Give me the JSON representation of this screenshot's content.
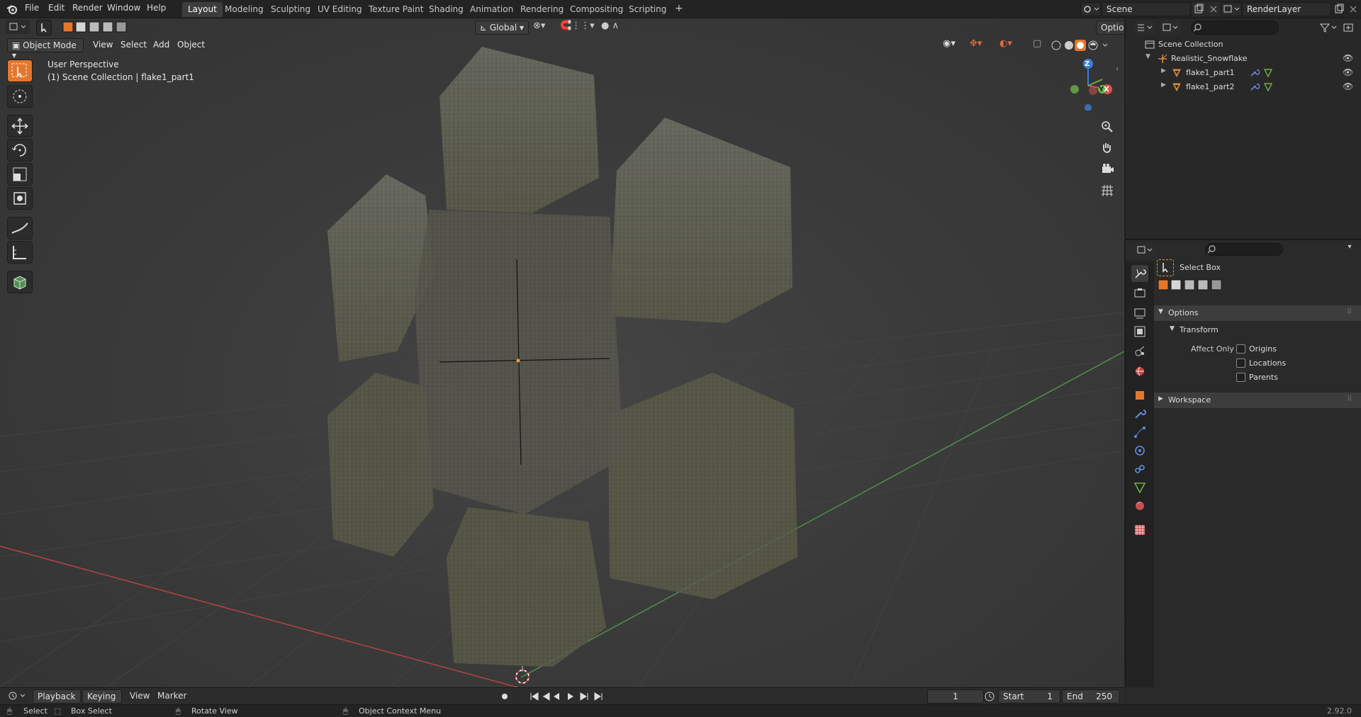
{
  "topbar": {
    "menu": [
      "File",
      "Edit",
      "Render",
      "Window",
      "Help"
    ],
    "workspaces": [
      "Layout",
      "Modeling",
      "Sculpting",
      "UV Editing",
      "Texture Paint",
      "Shading",
      "Animation",
      "Rendering",
      "Compositing",
      "Scripting"
    ],
    "active_workspace": "Layout",
    "add_workspace": "+",
    "scene_name": "Scene",
    "render_layer": "RenderLayer"
  },
  "viewport": {
    "mode": "Object Mode",
    "menu": [
      "View",
      "Select",
      "Add",
      "Object"
    ],
    "transform_orientation": "Global",
    "options_label": "Options",
    "perspective_label": "User Perspective",
    "collection_label": "(1) Scene Collection | flake1_part1",
    "gizmo": {
      "x": "X",
      "y": "Y",
      "z": "Z"
    }
  },
  "outliner": {
    "root": "Scene Collection",
    "collection": "Realistic_Snowflake",
    "objects": [
      "flake1_part1",
      "flake1_part2"
    ]
  },
  "properties": {
    "tool_name": "Select Box",
    "panels": {
      "options": "Options",
      "transform": "Transform",
      "affect_only_label": "Affect Only",
      "affect_options": [
        "Origins",
        "Locations",
        "Parents"
      ],
      "workspace": "Workspace"
    }
  },
  "timeline": {
    "menus": [
      "Playback",
      "Keying",
      "View",
      "Marker"
    ],
    "current_frame": "1",
    "start_label": "Start",
    "start_value": "1",
    "end_label": "End",
    "end_value": "250"
  },
  "statusbar": {
    "select": "Select",
    "box_select": "Box Select",
    "rotate_view": "Rotate View",
    "context_menu": "Object Context Menu",
    "version": "2.92.0"
  },
  "colors": {
    "accent": "#e5772d",
    "x_axis": "#d9534f",
    "y_axis": "#6ab04c",
    "z_axis": "#3b7dd8"
  }
}
